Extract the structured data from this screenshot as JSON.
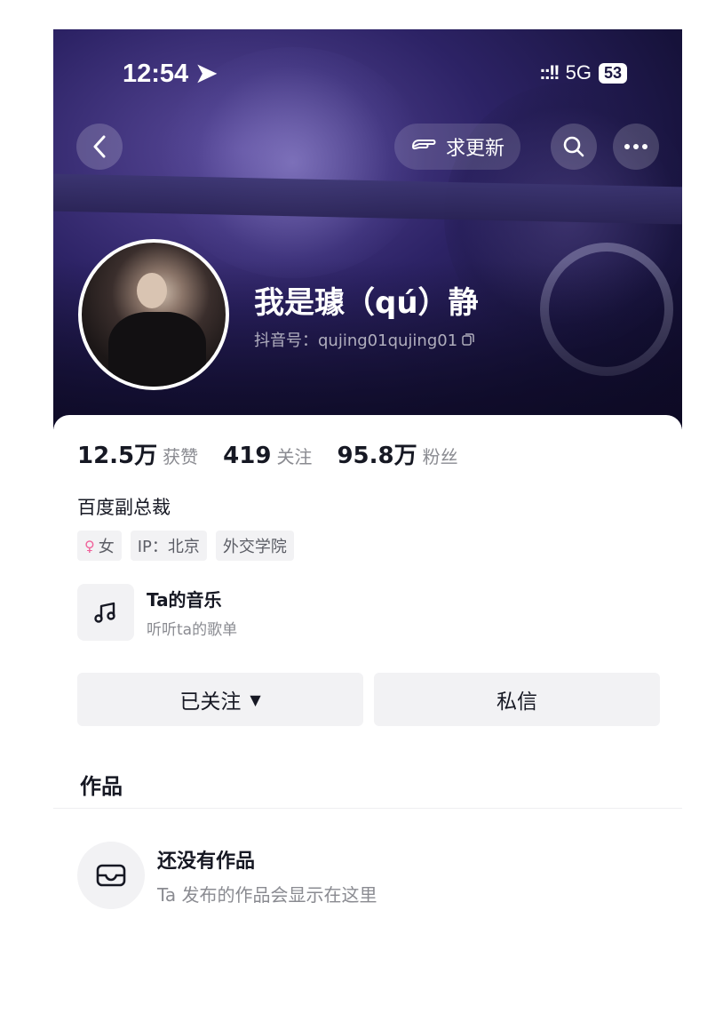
{
  "status_bar": {
    "time": "12:54 ➤",
    "signal": "::!!",
    "network": "5G",
    "battery": "53"
  },
  "nav": {
    "back_icon": "chevron-left-icon",
    "request_update_label": "求更新",
    "search_icon": "search-icon",
    "more_icon": "more-icon"
  },
  "profile": {
    "name": "我是璩（qú）静",
    "douyin_id": "抖音号：qujing01qujing01"
  },
  "stats": [
    {
      "value": "12.5万",
      "label": "获赞"
    },
    {
      "value": "419",
      "label": "关注"
    },
    {
      "value": "95.8万",
      "label": "粉丝"
    }
  ],
  "bio": "百度副总裁",
  "tags": {
    "gender": "女",
    "ip": "IP：北京",
    "school": "外交学院"
  },
  "music": {
    "title": "Ta的音乐",
    "subtitle": "听听ta的歌单"
  },
  "actions": {
    "followed_label": "已关注",
    "message_label": "私信"
  },
  "works": {
    "tab_label": "作品",
    "empty_title": "还没有作品",
    "empty_subtitle": "Ta 发布的作品会显示在这里"
  }
}
